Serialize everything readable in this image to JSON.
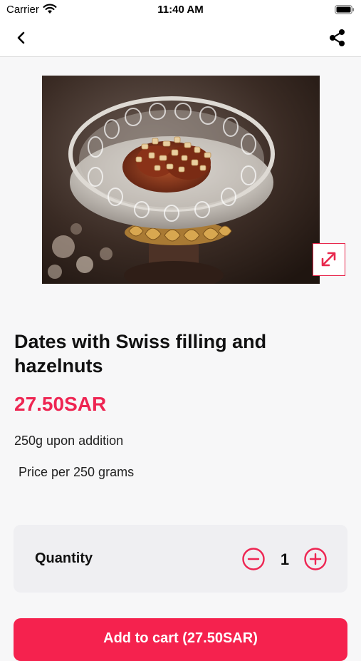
{
  "status_bar": {
    "carrier": "Carrier",
    "time": "11:40 AM"
  },
  "navbar": {
    "back_icon": "chevron-left-icon",
    "share_icon": "share-icon"
  },
  "product": {
    "image": "glass-bowl-of-dates-with-hazelnuts",
    "title": "Dates with Swiss filling and hazelnuts",
    "price": "27.50SAR",
    "description_1": "250g upon addition",
    "description_2": "Price per 250 grams"
  },
  "quantity": {
    "label": "Quantity",
    "value": "1"
  },
  "add_to_cart": {
    "label": "Add to cart (27.50SAR)"
  },
  "colors": {
    "accent": "#ee2552",
    "button": "#f5224e",
    "card": "#efeff2",
    "background": "#f7f7f8"
  }
}
